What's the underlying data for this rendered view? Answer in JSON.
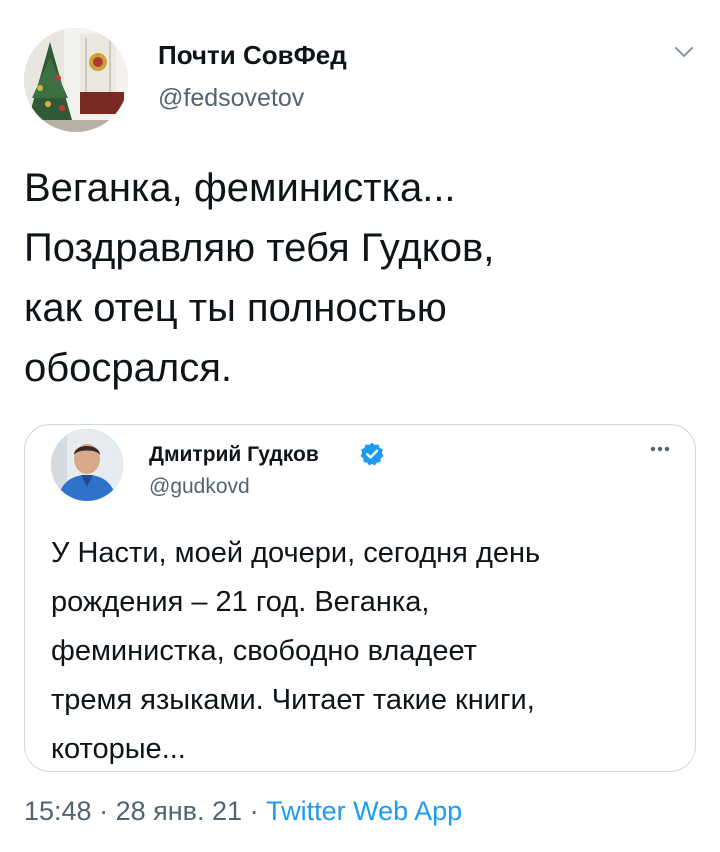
{
  "tweet": {
    "author_name": "Почти СовФед",
    "author_handle": "@fedsovetov",
    "text": "Веганка, феминистка...\nПоздравляю тебя Гудков,\nкак отец ты полностью\nобосрался.",
    "menu_icon": "chevron-down-icon"
  },
  "quoted_tweet": {
    "author_name": "Дмитрий Гудков",
    "author_handle": "@gudkovd",
    "verified_icon": "verified-badge-icon",
    "more_icon": "more-horizontal-icon",
    "text": "У Насти, моей дочери, сегодня день\nрождения – 21 год. Веганка,\nфеминистка, свободно владеет\nтремя языками. Читает такие книги,\nкоторые..."
  },
  "meta": {
    "time": "15:48",
    "separator": "·",
    "date": "28 янв. 21",
    "app": "Twitter Web App"
  },
  "colors": {
    "text": "#0f1419",
    "secondary": "#536471",
    "link": "#1d9bf0",
    "border": "#cfd9de"
  }
}
